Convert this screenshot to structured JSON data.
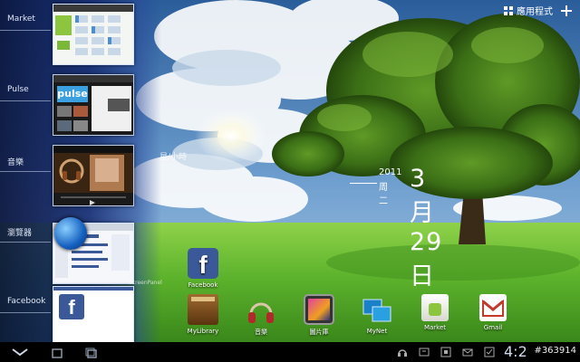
{
  "recents": [
    {
      "label": "Market",
      "icon": "market-thumbnail"
    },
    {
      "label": "Pulse",
      "icon": "pulse-thumbnail",
      "thumb_text": "pulse"
    },
    {
      "label": "音樂",
      "icon": "music-thumbnail"
    },
    {
      "label": "瀏覽器",
      "icon": "browser-thumbnail"
    },
    {
      "label": "Facebook",
      "icon": "facebook-thumbnail"
    }
  ],
  "top_right": {
    "apps_label": "應用程式",
    "add_icon": "plus-icon"
  },
  "clock": {
    "year": "2011",
    "weekday": "周二",
    "date": "3月29日",
    "ghost_text": "星/小時"
  },
  "dock": [
    {
      "label": "MyLibrary",
      "icon": "book-icon"
    },
    {
      "label": "音樂",
      "icon": "headphones-icon"
    },
    {
      "label": "圖片庫",
      "icon": "gallery-icon"
    },
    {
      "label": "MyNet",
      "icon": "mynet-icon"
    },
    {
      "label": "Market",
      "icon": "market-icon"
    },
    {
      "label": "Gmail",
      "icon": "gmail-icon"
    }
  ],
  "shortcut": {
    "label": "Facebook",
    "icon": "facebook-icon"
  },
  "widget_label": "ScreenPanel",
  "status": {
    "time": "4:2",
    "watermark": "#363914"
  }
}
